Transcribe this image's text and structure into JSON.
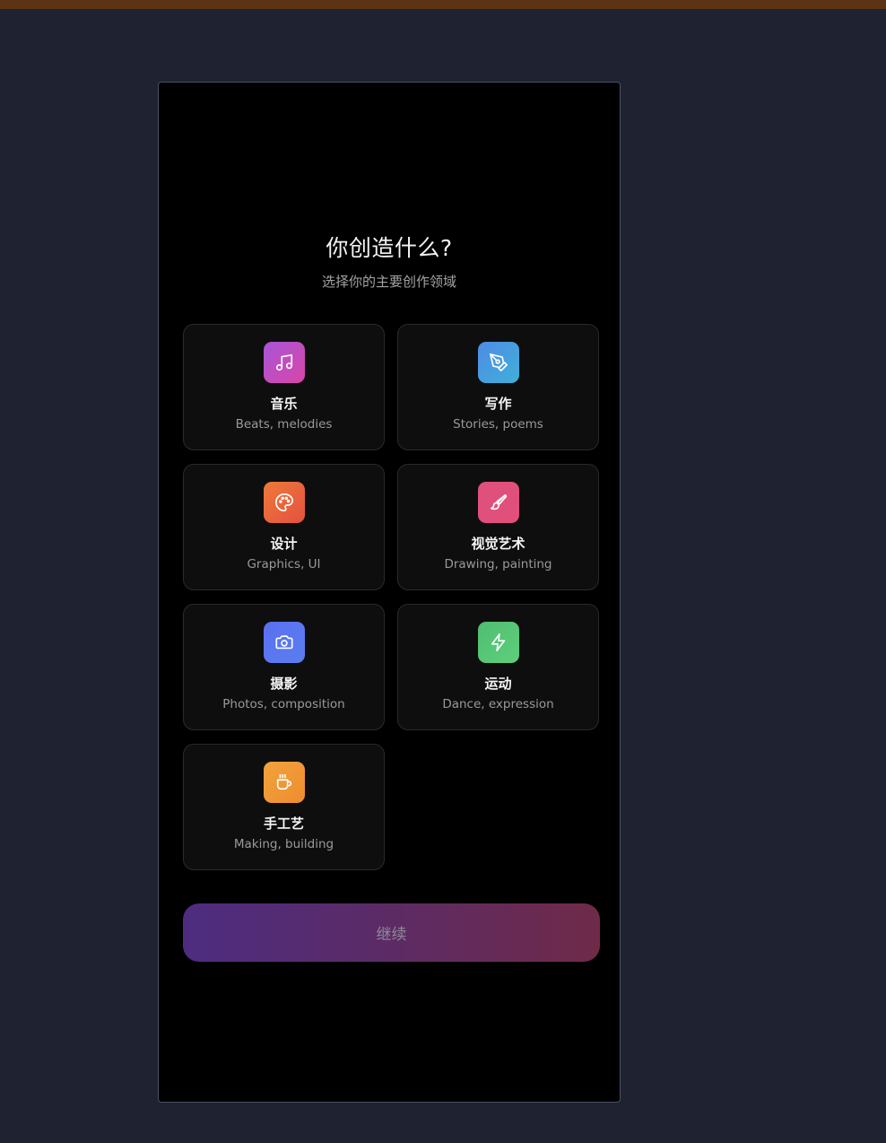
{
  "page": {
    "title": "你创造什么?",
    "subtitle": "选择你的主要创作领域"
  },
  "categories": [
    {
      "label": "音乐",
      "desc": "Beats, melodies",
      "icon": "music-note-icon",
      "gradient": [
        "#a855d8",
        "#d946a8"
      ]
    },
    {
      "label": "写作",
      "desc": "Stories, poems",
      "icon": "pen-icon",
      "gradient": [
        "#4f8be6",
        "#3fb0d8"
      ]
    },
    {
      "label": "设计",
      "desc": "Graphics, UI",
      "icon": "palette-icon",
      "gradient": [
        "#ee7a3a",
        "#e4513f"
      ]
    },
    {
      "label": "视觉艺术",
      "desc": "Drawing, painting",
      "icon": "brush-icon",
      "gradient": [
        "#e0507e",
        "#e14f7a"
      ]
    },
    {
      "label": "摄影",
      "desc": "Photos, composition",
      "icon": "camera-icon",
      "gradient": [
        "#5b6ff0",
        "#5a7ef0"
      ]
    },
    {
      "label": "运动",
      "desc": "Dance, expression",
      "icon": "lightning-icon",
      "gradient": [
        "#4fbd70",
        "#5fcf7c"
      ]
    },
    {
      "label": "手工艺",
      "desc": "Making, building",
      "icon": "mug-icon",
      "gradient": [
        "#f2a33c",
        "#ee8c2f"
      ]
    }
  ],
  "actions": {
    "continue_label": "继续"
  }
}
